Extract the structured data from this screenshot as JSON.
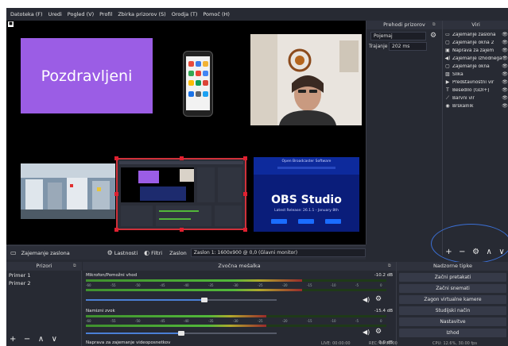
{
  "menu": [
    "Datoteka (F)",
    "Uredi",
    "Pogled (V)",
    "Profil",
    "Zbirka prizorov (S)",
    "Orodja (T)",
    "Pomoč (H)"
  ],
  "preview": {
    "greeting": "Pozdravljeni",
    "obs_title": "OBS Studio",
    "obs_subtitle": "Latest Release: 26.1.1 - January 8th",
    "obs_header": "Open Broadcaster Software"
  },
  "sourcebar": {
    "source_name": "Zajemanje zaslona",
    "properties": "Lastnosti",
    "filters": "Filtri",
    "screen_label": "Zaslon",
    "screen_value": "Zaslon 1: 1600x900 @ 0,0 (Glavni monitor)"
  },
  "transitions": {
    "title": "Prehodi prizorov",
    "type": "Pojemaj",
    "duration_label": "Trajanje",
    "duration_value": "202 ms"
  },
  "sources": {
    "title": "Viri",
    "items": [
      {
        "icon": "monitor-icon",
        "glyph": "▭",
        "label": "Zajemanje zaslona"
      },
      {
        "icon": "window-icon",
        "glyph": "▢",
        "label": "Zajemanje okna 2"
      },
      {
        "icon": "camera-icon",
        "glyph": "▣",
        "label": "Naprava za zajem"
      },
      {
        "icon": "speaker-icon",
        "glyph": "◀)",
        "label": "Zajemanje izhodnega zvoka"
      },
      {
        "icon": "window-icon",
        "glyph": "▢",
        "label": "Zajemanje okna"
      },
      {
        "icon": "image-icon",
        "glyph": "▨",
        "label": "Slika"
      },
      {
        "icon": "slideshow-icon",
        "glyph": "▶",
        "label": "Predstavnostni vir"
      },
      {
        "icon": "text-icon",
        "glyph": "T",
        "label": "Besedilo (GDI+)"
      },
      {
        "icon": "brush-icon",
        "glyph": "⟋",
        "label": "Barvni vir"
      },
      {
        "icon": "globe-icon",
        "glyph": "◉",
        "label": "Brskalnik"
      }
    ],
    "tools": [
      "+",
      "−",
      "⚙",
      "∧",
      "∨"
    ]
  },
  "scenes": {
    "title": "Prizori",
    "items": [
      "Primer 1",
      "Primer 2"
    ],
    "tools": [
      "+",
      "−",
      "∧",
      "∨"
    ]
  },
  "mixer": {
    "title": "Zvočna mešalka",
    "channels": [
      {
        "name": "Mikrofon/Pomožni vhod",
        "db": "-10.2 dB",
        "level": 0.72,
        "volume": 0.62
      },
      {
        "name": "Namizni zvok",
        "db": "-15.4 dB",
        "level": 0.6,
        "volume": 0.5
      },
      {
        "name": "Naprava za zajemanje videoposnetkov",
        "db": "0.0 dB"
      }
    ],
    "ticks": [
      "-60",
      "-55",
      "-50",
      "-45",
      "-40",
      "-35",
      "-30",
      "-25",
      "-20",
      "-15",
      "-10",
      "-5",
      "0"
    ]
  },
  "controls": {
    "title": "Nadzorne tipke",
    "buttons": [
      "Začni pretakati",
      "Začni snemati",
      "Zagon virtualne kamere",
      "Studijski način",
      "Nastavitve",
      "Izhod"
    ]
  },
  "status": {
    "live": "LIVE: 00:00:00",
    "rec": "REC: 00:00:00",
    "cpu": "CPU: 12.6%, 30.00 fps"
  }
}
